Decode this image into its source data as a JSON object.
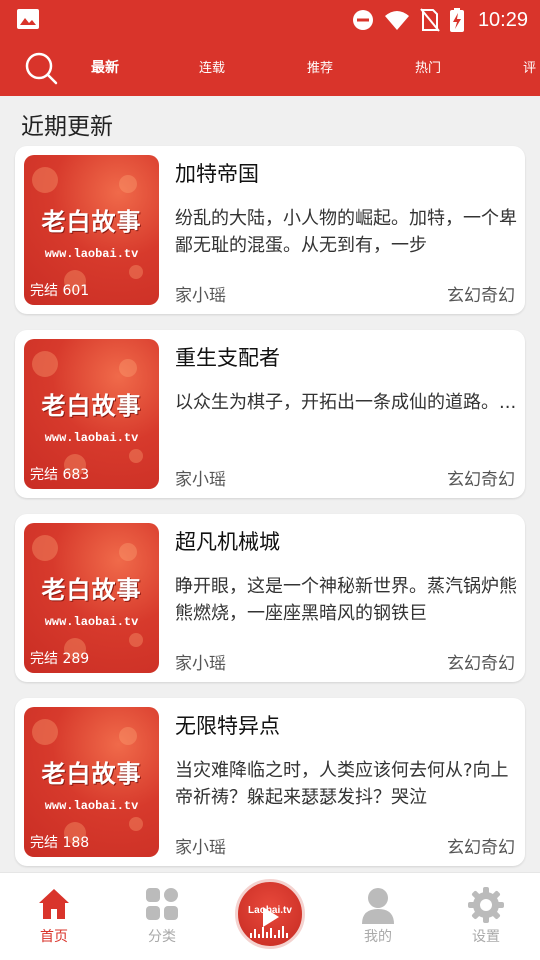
{
  "status_bar": {
    "time": "10:29"
  },
  "top_nav": {
    "tabs": [
      {
        "label": "最新",
        "active": true
      },
      {
        "label": "连载",
        "active": false
      },
      {
        "label": "推荐",
        "active": false
      },
      {
        "label": "热门",
        "active": false
      },
      {
        "label": "评",
        "active": false
      }
    ]
  },
  "section_title": "近期更新",
  "cover_art": {
    "logo_text": "老白故事",
    "url_text": "www.laobai.tv"
  },
  "books": [
    {
      "title": "加特帝国",
      "status": "完结 601",
      "description": "纷乱的大陆，小人物的崛起。加特，一个卑鄙无耻的混蛋。从无到有，一步",
      "author": "家小瑶",
      "genre": "玄幻奇幻"
    },
    {
      "title": "重生支配者",
      "status": "完结 683",
      "description": "以众生为棋子，开拓出一条成仙的道路。...",
      "author": "家小瑶",
      "genre": "玄幻奇幻"
    },
    {
      "title": "超凡机械城",
      "status": "完结 289",
      "description": "睁开眼，这是一个神秘新世界。蒸汽锅炉熊熊燃烧，一座座黑暗风的钢铁巨",
      "author": "家小瑶",
      "genre": "玄幻奇幻"
    },
    {
      "title": "无限特异点",
      "status": "完结 188",
      "description": "当灾难降临之时，人类应该何去何从?向上帝祈祷？躲起来瑟瑟发抖？哭泣",
      "author": "家小瑶",
      "genre": "玄幻奇幻"
    }
  ],
  "bottom_nav": {
    "items": [
      {
        "label": "首页",
        "icon": "home-icon",
        "active": true
      },
      {
        "label": "分类",
        "icon": "category-icon",
        "active": false
      },
      {
        "label": "我的",
        "icon": "user-icon",
        "active": false
      },
      {
        "label": "设置",
        "icon": "gear-icon",
        "active": false
      }
    ],
    "center_button_text": "Laobai.tv"
  },
  "colors": {
    "brand_red": "#d9342b",
    "inactive_gray": "#aaaaaa"
  }
}
